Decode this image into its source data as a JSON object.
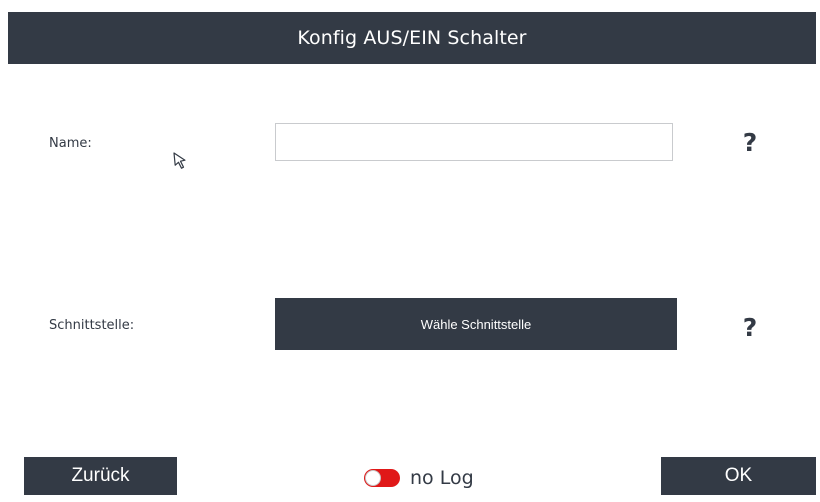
{
  "header": {
    "title": "Konfig AUS/EIN Schalter"
  },
  "form": {
    "name_label": "Name:",
    "name_value": "",
    "name_placeholder": "",
    "interface_label": "Schnittstelle:",
    "interface_button_label": "Wähle Schnittstelle",
    "help_symbol": "?"
  },
  "footer": {
    "back_label": "Zurück",
    "log_label": "no Log",
    "ok_label": "OK",
    "log_enabled": false
  },
  "colors": {
    "primary_dark": "#333a45",
    "toggle_red": "#e01818",
    "background": "#ffffff",
    "input_border": "#c9cbce"
  },
  "icons": {
    "cursor": "mouse-pointer-icon",
    "help": "help-icon"
  }
}
